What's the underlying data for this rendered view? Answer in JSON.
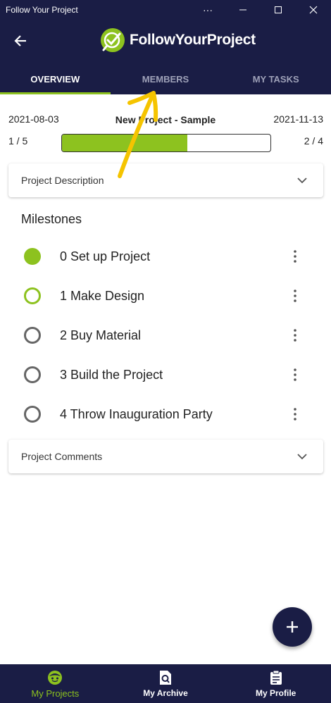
{
  "window": {
    "title": "Follow Your Project",
    "more_glyph": "···"
  },
  "app": {
    "brand_name": "FollowYourProject"
  },
  "tabs": [
    {
      "label": "OVERVIEW",
      "active": true
    },
    {
      "label": "MEMBERS",
      "active": false
    },
    {
      "label": "MY TASKS",
      "active": false
    }
  ],
  "project": {
    "name": "New Project - Sample",
    "start_date": "2021-08-03",
    "end_date": "2021-11-13",
    "completed_count": "1 / 5",
    "remaining_count": "2 / 4",
    "progress_fraction": 0.6
  },
  "description_card": {
    "label": "Project Description"
  },
  "milestones": {
    "title": "Milestones",
    "items": [
      {
        "label": "0 Set up Project",
        "status": "done"
      },
      {
        "label": "1 Make Design",
        "status": "current"
      },
      {
        "label": "2 Buy Material",
        "status": "todo"
      },
      {
        "label": "3 Build the Project",
        "status": "todo"
      },
      {
        "label": "4 Throw Inauguration Party",
        "status": "todo"
      }
    ]
  },
  "comments_card": {
    "label": "Project Comments"
  },
  "bottom_nav": [
    {
      "label": "My Projects",
      "icon": "smiley-icon",
      "active": true
    },
    {
      "label": "My Archive",
      "icon": "archive-search-icon",
      "active": false
    },
    {
      "label": "My Profile",
      "icon": "clipboard-icon",
      "active": false
    }
  ],
  "colors": {
    "navy": "#1a1d45",
    "accent": "#8dc21f",
    "annotation": "#f5c400"
  }
}
